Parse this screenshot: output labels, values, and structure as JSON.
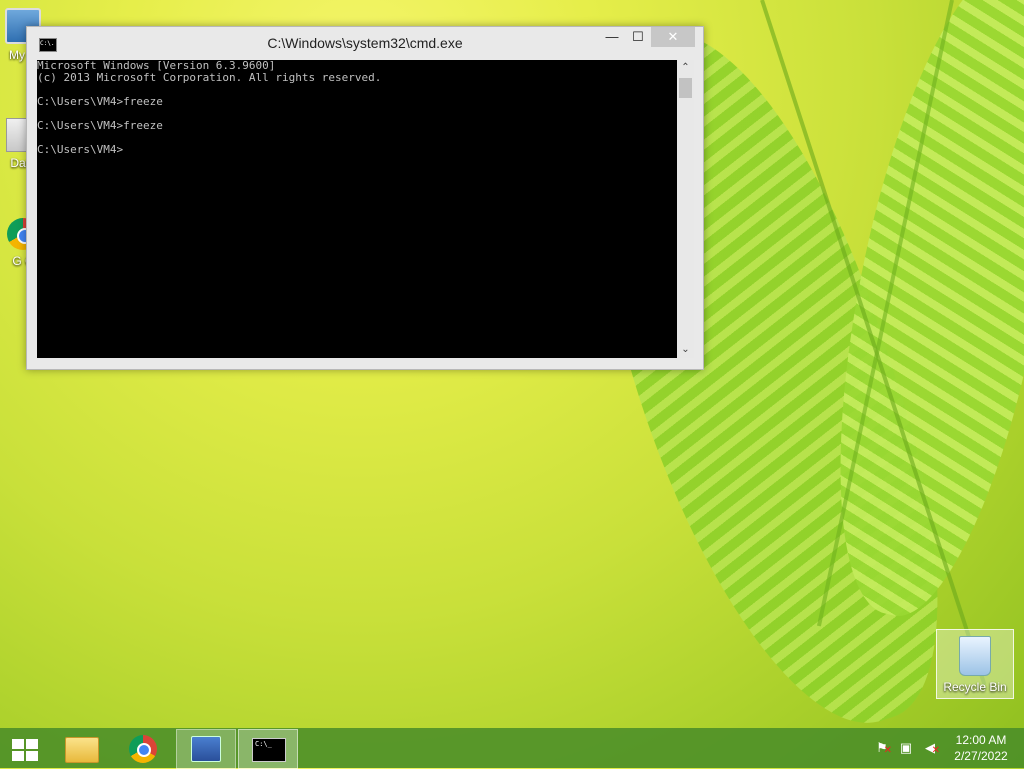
{
  "desktop": {
    "icons": [
      {
        "label": "My C"
      },
      {
        "label": "Data"
      },
      {
        "label": "G C"
      }
    ],
    "recycle_bin": {
      "label": "Recycle Bin"
    }
  },
  "window": {
    "title": "C:\\Windows\\system32\\cmd.exe",
    "icon_text": "C:\\.",
    "min_glyph": "—",
    "max_glyph": "☐",
    "close_glyph": "✕",
    "console_lines": [
      "Microsoft Windows [Version 6.3.9600]",
      "(c) 2013 Microsoft Corporation. All rights reserved.",
      "",
      "C:\\Users\\VM4>freeze",
      "",
      "C:\\Users\\VM4>freeze",
      "",
      "C:\\Users\\VM4>"
    ],
    "scroll_up_glyph": "⌃",
    "scroll_down_glyph": "⌄"
  },
  "taskbar": {
    "cmd_icon_text": "C:\\_",
    "tray": {
      "flag_glyph": "⚑",
      "network_glyph": "▣",
      "volume_glyph": "◀",
      "error_mark": "✕"
    },
    "clock": {
      "time": "12:00 AM",
      "date": "2/27/2022"
    }
  }
}
